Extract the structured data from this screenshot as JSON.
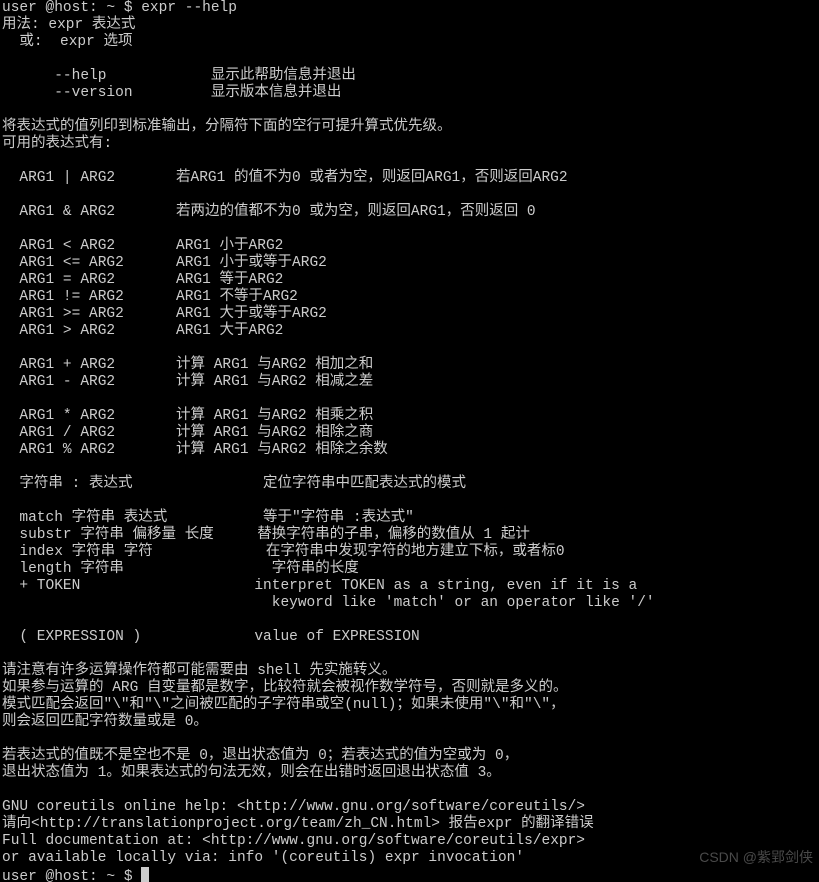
{
  "prompt1": {
    "user": "user @host",
    "sep": ": ~ $ ",
    "command": "expr --help"
  },
  "help": {
    "l01": "用法: expr 表达式",
    "l02": "  或:  expr 选项",
    "l03": "",
    "l04": "      --help            显示此帮助信息并退出",
    "l05": "      --version         显示版本信息并退出",
    "l06": "",
    "l07": "将表达式的值列印到标准输出，分隔符下面的空行可提升算式优先级。",
    "l08": "可用的表达式有:",
    "l09": "",
    "l10": "  ARG1 | ARG2       若ARG1 的值不为0 或者为空，则返回ARG1，否则返回ARG2",
    "l11": "",
    "l12": "  ARG1 & ARG2       若两边的值都不为0 或为空，则返回ARG1，否则返回 0",
    "l13": "",
    "l14": "  ARG1 < ARG2       ARG1 小于ARG2",
    "l15": "  ARG1 <= ARG2      ARG1 小于或等于ARG2",
    "l16": "  ARG1 = ARG2       ARG1 等于ARG2",
    "l17": "  ARG1 != ARG2      ARG1 不等于ARG2",
    "l18": "  ARG1 >= ARG2      ARG1 大于或等于ARG2",
    "l19": "  ARG1 > ARG2       ARG1 大于ARG2",
    "l20": "",
    "l21": "  ARG1 + ARG2       计算 ARG1 与ARG2 相加之和",
    "l22": "  ARG1 - ARG2       计算 ARG1 与ARG2 相减之差",
    "l23": "",
    "l24": "  ARG1 * ARG2       计算 ARG1 与ARG2 相乘之积",
    "l25": "  ARG1 / ARG2       计算 ARG1 与ARG2 相除之商",
    "l26": "  ARG1 % ARG2       计算 ARG1 与ARG2 相除之余数",
    "l27": "",
    "l28": "  字符串 : 表达式               定位字符串中匹配表达式的模式",
    "l29": "",
    "l30": "  match 字符串 表达式           等于\"字符串 :表达式\"",
    "l31": "  substr 字符串 偏移量 长度     替换字符串的子串，偏移的数值从 1 起计",
    "l32": "  index 字符串 字符             在字符串中发现字符的地方建立下标，或者标0",
    "l33": "  length 字符串                 字符串的长度",
    "l34": "  + TOKEN                    interpret TOKEN as a string, even if it is a",
    "l35": "                               keyword like 'match' or an operator like '/'",
    "l36": "",
    "l37": "  ( EXPRESSION )             value of EXPRESSION",
    "l38": "",
    "l39": "请注意有许多运算操作符都可能需要由 shell 先实施转义。",
    "l40": "如果参与运算的 ARG 自变量都是数字，比较符就会被视作数学符号，否则就是多义的。",
    "l41": "模式匹配会返回\"\\\"和\"\\\"之间被匹配的子字符串或空(null)；如果未使用\"\\\"和\"\\\"，",
    "l42": "则会返回匹配字符数量或是 0。",
    "l43": "",
    "l44": "若表达式的值既不是空也不是 0，退出状态值为 0；若表达式的值为空或为 0，",
    "l45": "退出状态值为 1。如果表达式的句法无效，则会在出错时返回退出状态值 3。",
    "l46": "",
    "l47": "GNU coreutils online help: <http://www.gnu.org/software/coreutils/>",
    "l48": "请向<http://translationproject.org/team/zh_CN.html> 报告expr 的翻译错误",
    "l49": "Full documentation at: <http://www.gnu.org/software/coreutils/expr>",
    "l50": "or available locally via: info '(coreutils) expr invocation'"
  },
  "prompt2": {
    "user": "user @host",
    "sep": ": ~ $ "
  },
  "watermark": "CSDN @紫郢剑侠"
}
